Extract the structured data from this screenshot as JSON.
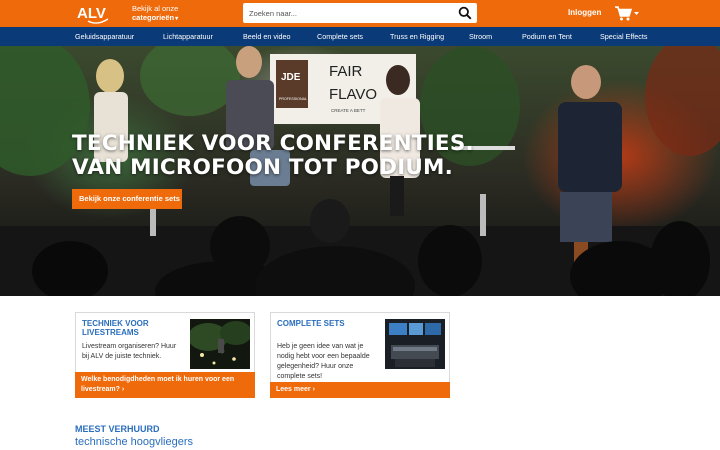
{
  "header": {
    "logo_text": "ALV",
    "categories_line1": "Bekijk al onze",
    "categories_line2": "categorieën",
    "search_placeholder": "Zoeken naar...",
    "login_label": "Inloggen",
    "brand_color": "#ef6a0b",
    "nav_color": "#0a3a78"
  },
  "nav": {
    "items": [
      "Geluidsapparatuur",
      "Lichtapparatuur",
      "Beeld en video",
      "Complete sets",
      "Truss en Rigging",
      "Stroom",
      "Podium en Tent",
      "Special Effects"
    ]
  },
  "hero": {
    "title_line1": "TECHNIEK VOOR CONFERENTIES.",
    "title_line2": "VAN MICROFOON TOT PODIUM.",
    "button_label": "Bekijk onze conferentie sets",
    "sign_brand": "JDE",
    "sign_brand_sub": "PROFESSIONAL",
    "sign_text_line1": "FAIR",
    "sign_text_line2": "FLAVO",
    "sign_tagline": "CREATE A BETT"
  },
  "cards": [
    {
      "title": "Techniek voor livestreams",
      "text": "Livestream organiseren? Huur bij ALV de juiste techniek.",
      "footer": "Welke benodigdheden moet ik huren voor een livestream? ›"
    },
    {
      "title": "Complete sets",
      "text": "Heb je geen idee van wat je nodig hebt voor een bepaalde gelegenheid? Huur onze complete sets!",
      "footer": "Lees meer ›"
    }
  ],
  "section": {
    "heading": "Meest verhuurd",
    "subheading": "technische hoogvliegers"
  }
}
